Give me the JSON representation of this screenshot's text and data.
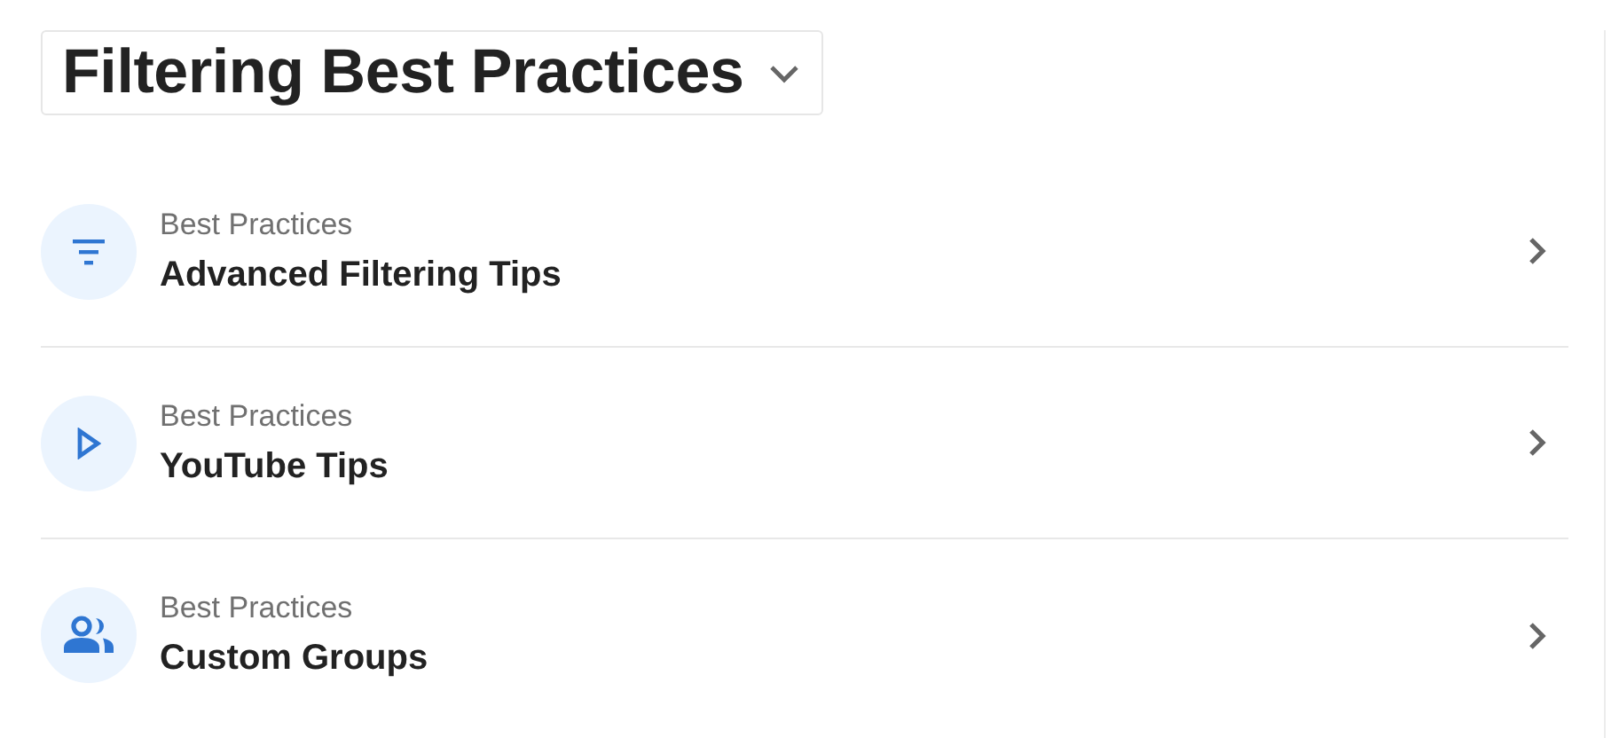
{
  "header": {
    "title": "Filtering Best Practices"
  },
  "items": [
    {
      "kind": "filter",
      "category": "Best Practices",
      "title": "Advanced Filtering Tips"
    },
    {
      "kind": "play",
      "category": "Best Practices",
      "title": "YouTube Tips"
    },
    {
      "kind": "people",
      "category": "Best Practices",
      "title": "Custom Groups"
    }
  ]
}
